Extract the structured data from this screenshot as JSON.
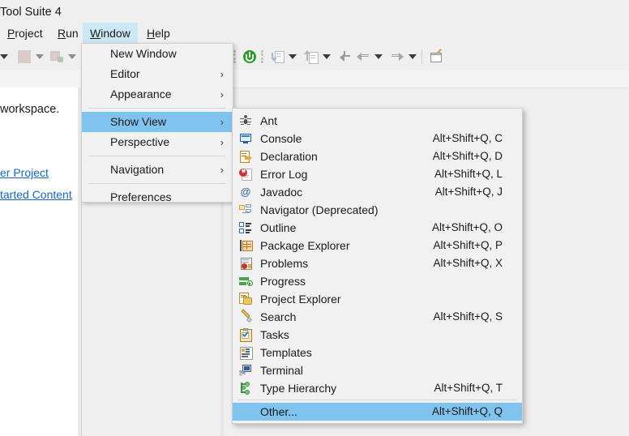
{
  "app": {
    "title": "Tool Suite 4"
  },
  "menubar": {
    "items": [
      {
        "label": "Project",
        "mnemonic": "P",
        "active": false
      },
      {
        "label": "Run",
        "mnemonic": "R",
        "active": false
      },
      {
        "label": "Window",
        "mnemonic": "W",
        "active": true
      },
      {
        "label": "Help",
        "mnemonic": "H",
        "active": false
      }
    ]
  },
  "left_panel": {
    "text": "workspace.",
    "links": [
      "er Project",
      "tarted Content"
    ]
  },
  "window_menu": {
    "items": [
      {
        "label": "New Window",
        "submenu": false,
        "selected": false,
        "separator_before": false
      },
      {
        "label": "Editor",
        "submenu": true,
        "selected": false,
        "separator_before": false
      },
      {
        "label": "Appearance",
        "submenu": true,
        "selected": false,
        "separator_before": false
      },
      {
        "label": "Show View",
        "submenu": true,
        "selected": true,
        "separator_before": true
      },
      {
        "label": "Perspective",
        "submenu": true,
        "selected": false,
        "separator_before": false
      },
      {
        "label": "Navigation",
        "submenu": true,
        "selected": false,
        "separator_before": true
      },
      {
        "label": "Preferences",
        "submenu": false,
        "selected": false,
        "separator_before": true
      }
    ],
    "submenu_arrow": "›"
  },
  "show_view_menu": {
    "items": [
      {
        "label": "Ant",
        "shortcut": "",
        "icon": "ant-icon",
        "selected": false,
        "separator_before": false
      },
      {
        "label": "Console",
        "shortcut": "Alt+Shift+Q, C",
        "icon": "console-icon",
        "selected": false,
        "separator_before": false
      },
      {
        "label": "Declaration",
        "shortcut": "Alt+Shift+Q, D",
        "icon": "declaration-icon",
        "selected": false,
        "separator_before": false
      },
      {
        "label": "Error Log",
        "shortcut": "Alt+Shift+Q, L",
        "icon": "error-log-icon",
        "selected": false,
        "separator_before": false
      },
      {
        "label": "Javadoc",
        "shortcut": "Alt+Shift+Q, J",
        "icon": "javadoc-icon",
        "selected": false,
        "separator_before": false
      },
      {
        "label": "Navigator (Deprecated)",
        "shortcut": "",
        "icon": "navigator-icon",
        "selected": false,
        "separator_before": false
      },
      {
        "label": "Outline",
        "shortcut": "Alt+Shift+Q, O",
        "icon": "outline-icon",
        "selected": false,
        "separator_before": false
      },
      {
        "label": "Package Explorer",
        "shortcut": "Alt+Shift+Q, P",
        "icon": "package-explorer-icon",
        "selected": false,
        "separator_before": false
      },
      {
        "label": "Problems",
        "shortcut": "Alt+Shift+Q, X",
        "icon": "problems-icon",
        "selected": false,
        "separator_before": false
      },
      {
        "label": "Progress",
        "shortcut": "",
        "icon": "progress-icon",
        "selected": false,
        "separator_before": false
      },
      {
        "label": "Project Explorer",
        "shortcut": "",
        "icon": "project-explorer-icon",
        "selected": false,
        "separator_before": false
      },
      {
        "label": "Search",
        "shortcut": "Alt+Shift+Q, S",
        "icon": "search-icon",
        "selected": false,
        "separator_before": false
      },
      {
        "label": "Tasks",
        "shortcut": "",
        "icon": "tasks-icon",
        "selected": false,
        "separator_before": false
      },
      {
        "label": "Templates",
        "shortcut": "",
        "icon": "templates-icon",
        "selected": false,
        "separator_before": false
      },
      {
        "label": "Terminal",
        "shortcut": "",
        "icon": "terminal-icon",
        "selected": false,
        "separator_before": false
      },
      {
        "label": "Type Hierarchy",
        "shortcut": "Alt+Shift+Q, T",
        "icon": "type-hierarchy-icon",
        "selected": false,
        "separator_before": false
      },
      {
        "label": "Other...",
        "shortcut": "Alt+Shift+Q, Q",
        "icon": "",
        "selected": true,
        "separator_before": true
      }
    ]
  },
  "toolbar": {
    "items": [
      {
        "name": "dropdown-caret-1",
        "type": "caret"
      },
      {
        "name": "stop-button",
        "type": "square"
      },
      {
        "name": "dropdown-caret-2",
        "type": "caret"
      },
      {
        "name": "debug-button",
        "type": "square-pale"
      },
      {
        "name": "dropdown-caret-3",
        "type": "caret"
      },
      {
        "name": "run-button",
        "type": "power"
      },
      {
        "name": "step-into-button",
        "type": "step-down"
      },
      {
        "name": "dropdown-caret-4",
        "type": "caret"
      },
      {
        "name": "step-out-button",
        "type": "step-up"
      },
      {
        "name": "dropdown-caret-5",
        "type": "caret"
      },
      {
        "name": "back-pointer-button",
        "type": "arrow-left-tail"
      },
      {
        "name": "back-button",
        "type": "arrow-left"
      },
      {
        "name": "dropdown-caret-6",
        "type": "caret"
      },
      {
        "name": "forward-button",
        "type": "arrow-right"
      },
      {
        "name": "dropdown-caret-7",
        "type": "caret"
      },
      {
        "name": "new-editor-button",
        "type": "page"
      }
    ]
  },
  "colors": {
    "menu_bg": "#f1f1f1",
    "menu_border": "#cfcfcf",
    "highlight": "#7fc3ef",
    "menubar_highlight": "#cce8f4",
    "link": "#1266c6",
    "app_bg": "#efefef",
    "run_green": "#23a024"
  }
}
